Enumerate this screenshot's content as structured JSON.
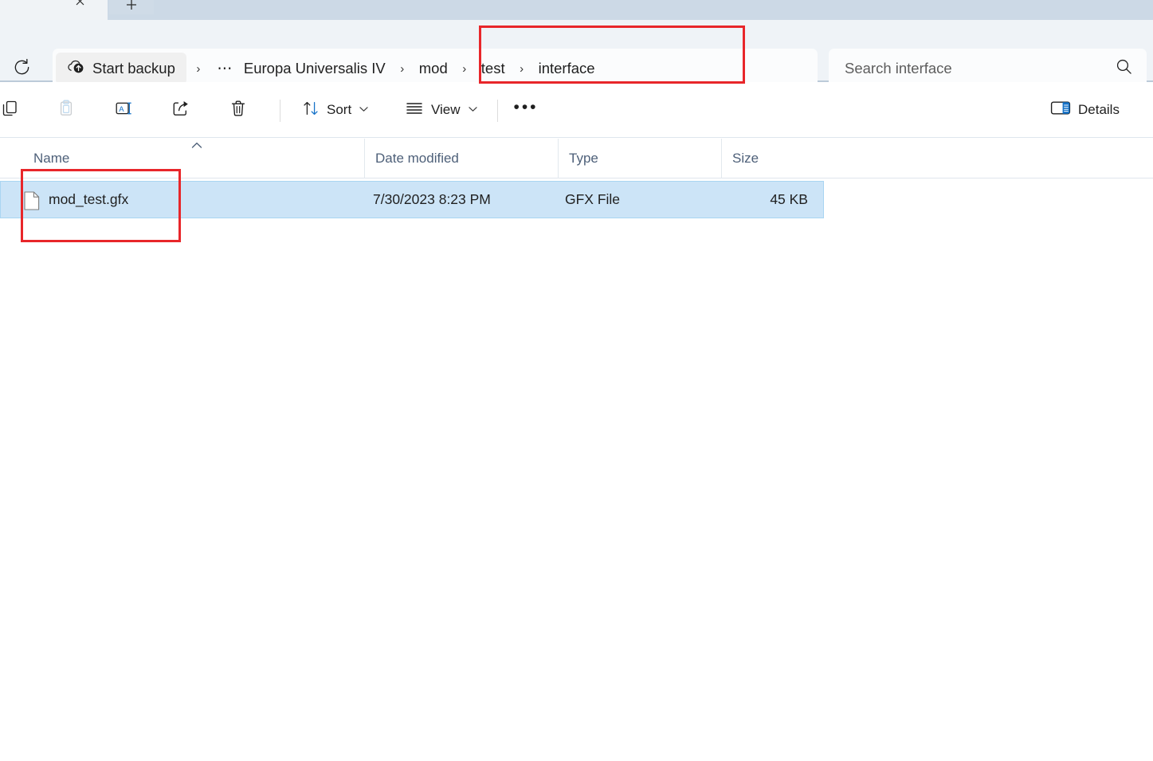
{
  "window": {
    "app": "File Explorer",
    "tab": {
      "close_label": "✕",
      "new_tab_label": "+"
    }
  },
  "addressbar": {
    "refresh_tooltip": "Refresh",
    "backup_label": "Start backup",
    "overflow_label": "…",
    "crumbs": [
      {
        "label": "Europa Universalis IV"
      },
      {
        "label": "mod"
      },
      {
        "label": "test"
      },
      {
        "label": "interface"
      }
    ],
    "separator": "›",
    "search": {
      "placeholder": "Search interface",
      "value": ""
    }
  },
  "toolbar": {
    "copy_label": "Copy",
    "paste_label": "Paste",
    "rename_label": "Rename",
    "share_label": "Share",
    "delete_label": "Delete",
    "sort_label": "Sort",
    "view_label": "View",
    "more_label": "•••",
    "details_label": "Details",
    "chevron": "∨"
  },
  "columns": [
    {
      "key": "name",
      "label": "Name",
      "sorted": "asc",
      "sort_glyph": "⌃"
    },
    {
      "key": "date",
      "label": "Date modified"
    },
    {
      "key": "type",
      "label": "Type"
    },
    {
      "key": "size",
      "label": "Size"
    }
  ],
  "files": [
    {
      "name": "mod_test.gfx",
      "date": "7/30/2023 8:23 PM",
      "type": "GFX File",
      "size": "45 KB",
      "selected": true,
      "icon": "generic-file-icon"
    }
  ],
  "annotations": [
    {
      "id": "breadcrumb-highlight",
      "color": "#e8262a"
    },
    {
      "id": "filename-highlight",
      "color": "#e8262a"
    }
  ],
  "colors": {
    "accent": "#0f6cbd",
    "selection": "#cce4f7",
    "selection_border": "#a9d5f2",
    "annotation_red": "#e8262a",
    "tabstrip_bg": "#ccd9e6",
    "addressbar_bg": "#eff3f7",
    "header_text": "#4e6079"
  }
}
